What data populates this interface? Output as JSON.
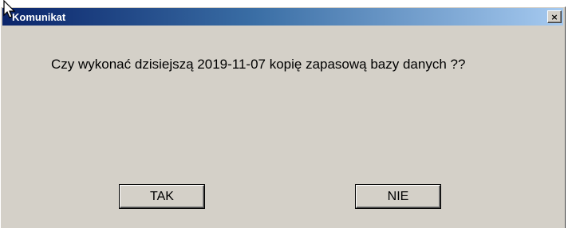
{
  "window": {
    "title": "Komunikat",
    "close_label": "×"
  },
  "message": {
    "text": "Czy wykonać dzisiejszą 2019-11-07 kopię zapasową bazy danych ??"
  },
  "buttons": {
    "yes_label": "TAK",
    "no_label": "NIE"
  },
  "colors": {
    "dialog_bg": "#d4d0c8",
    "titlebar_start": "#0a246a",
    "titlebar_end": "#a6caf0",
    "title_text": "#ffffff"
  },
  "icons": {
    "cursor": "mouse-pointer-icon"
  }
}
